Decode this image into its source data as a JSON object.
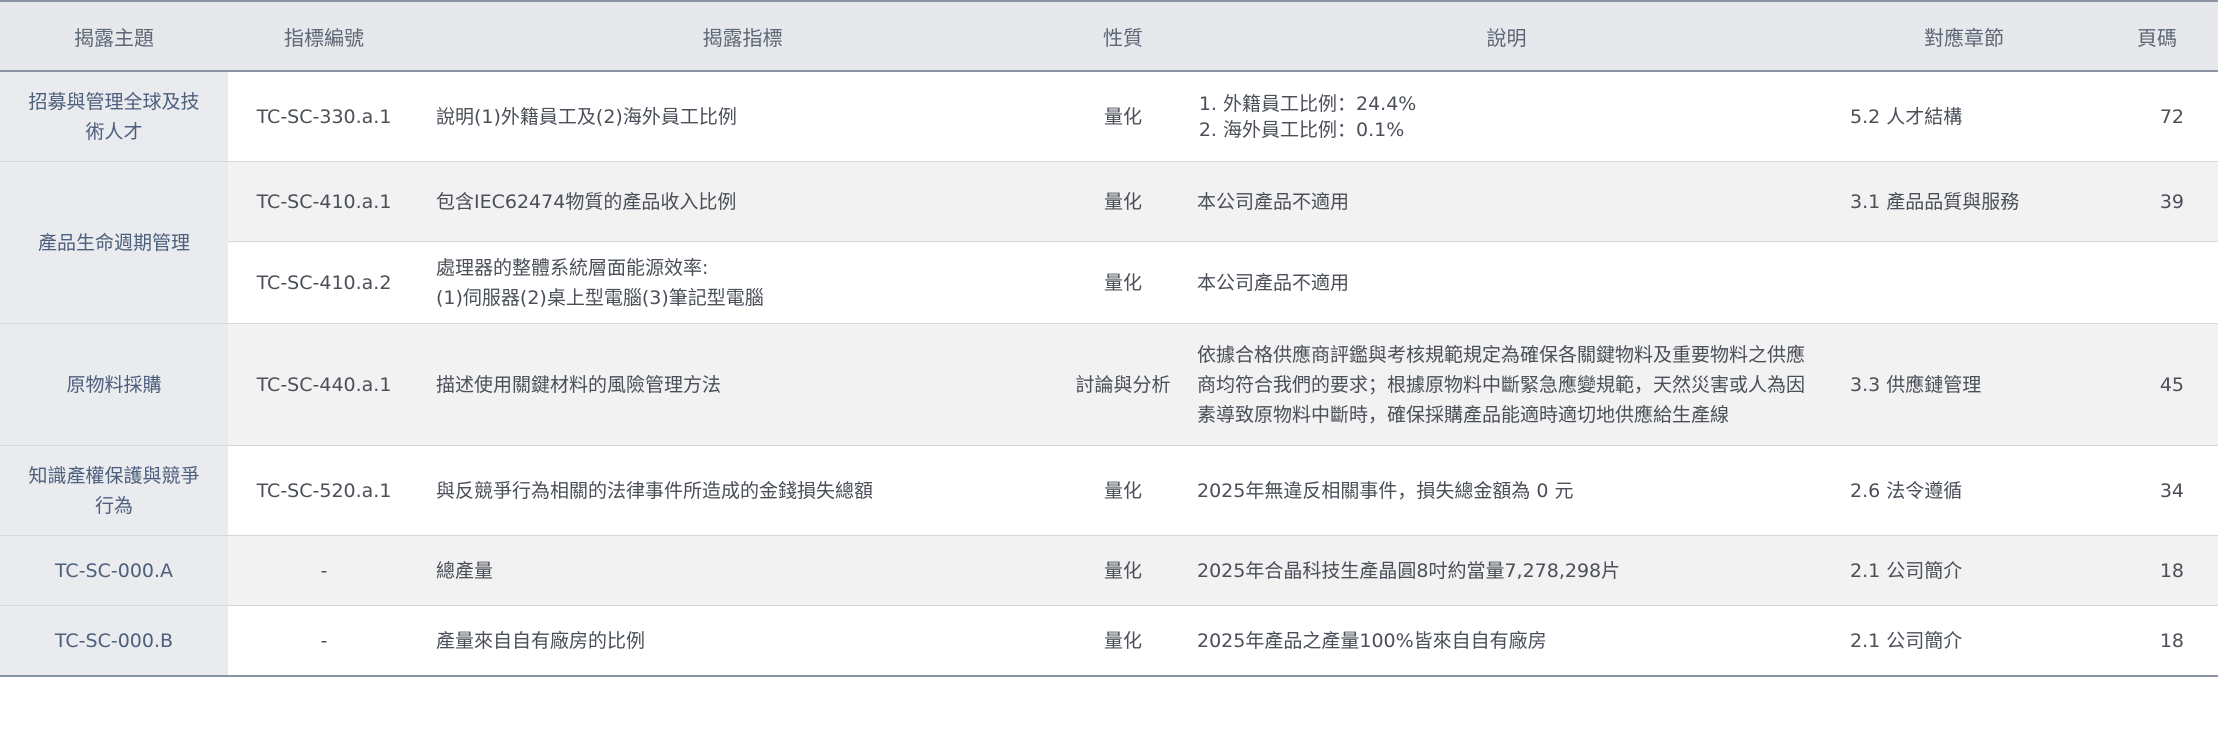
{
  "header": {
    "topic": "揭露主題",
    "code": "指標編號",
    "indicator": "揭露指標",
    "nature": "性質",
    "description": "說明",
    "section": "對應章節",
    "page": "頁碼"
  },
  "rows": [
    {
      "topic": "招募與管理全球及技術人才",
      "code": "TC-SC-330.a.1",
      "indicator": "說明(1)外籍員工及(2)海外員工比例",
      "nature": "量化",
      "description_items": [
        "外籍員工比例：24.4%",
        "海外員工比例：0.1%"
      ],
      "section": "5.2 人才結構",
      "page": "72"
    },
    {
      "topic": "產品生命週期管理",
      "code": "TC-SC-410.a.1",
      "indicator": "包含IEC62474物質的產品收入比例",
      "nature": "量化",
      "description": "本公司產品不適用",
      "section": "3.1 產品品質與服務",
      "page": "39"
    },
    {
      "code": "TC-SC-410.a.2",
      "indicator_line1": "處理器的整體系統層面能源效率:",
      "indicator_line2": "(1)伺服器(2)桌上型電腦(3)筆記型電腦",
      "nature": "量化",
      "description": "本公司產品不適用",
      "section": "",
      "page": ""
    },
    {
      "topic": "原物料採購",
      "code": "TC-SC-440.a.1",
      "indicator": "描述使用關鍵材料的風險管理方法",
      "nature": "討論與分析",
      "description": "依據合格供應商評鑑與考核規範規定為確保各關鍵物料及重要物料之供應商均符合我們的要求；根據原物料中斷緊急應變規範，天然災害或人為因素導致原物料中斷時，確保採購產品能適時適切地供應給生產線",
      "section": "3.3 供應鏈管理",
      "page": "45"
    },
    {
      "topic": "知識產權保護與競爭行為",
      "code": "TC-SC-520.a.1",
      "indicator": "與反競爭行為相關的法律事件所造成的金錢損失總額",
      "nature": "量化",
      "description": "2025年無違反相關事件，損失總金額為 0 元",
      "section": "2.6 法令遵循",
      "page": "34"
    },
    {
      "topic": "TC-SC-000.A",
      "code": "-",
      "indicator": "總產量",
      "nature": "量化",
      "description": "2025年合晶科技生產晶圓8吋約當量7,278,298片",
      "section": "2.1 公司簡介",
      "page": "18"
    },
    {
      "topic": "TC-SC-000.B",
      "code": "-",
      "indicator": "產量來自自有廠房的比例",
      "nature": "量化",
      "description": "2025年產品之產量100%皆來自自有廠房",
      "section": "2.1 公司簡介",
      "page": "18"
    }
  ]
}
